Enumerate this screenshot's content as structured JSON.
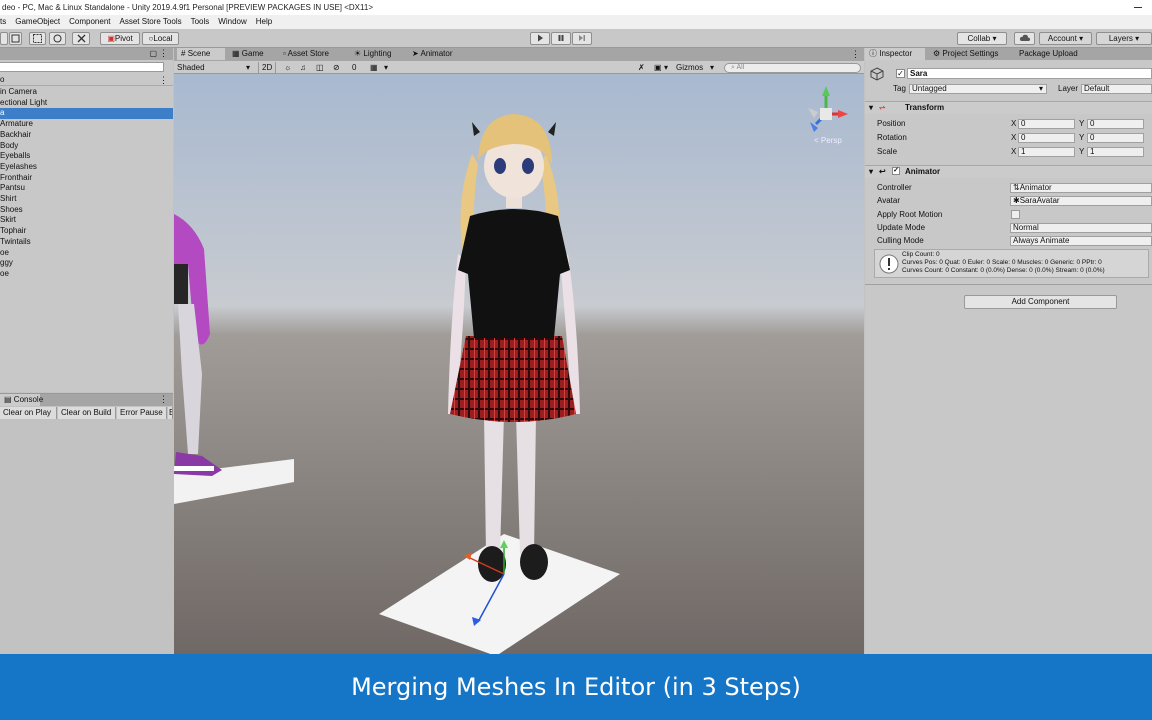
{
  "window": {
    "title": "deo - PC, Mac & Linux Standalone - Unity 2019.4.9f1 Personal [PREVIEW PACKAGES IN USE] <DX11>"
  },
  "menu": [
    "ts",
    "GameObject",
    "Component",
    "Asset Store Tools",
    "Tools",
    "Window",
    "Help"
  ],
  "toolbar": {
    "pivot": "Pivot",
    "local": "Local",
    "collab": "Collab",
    "account": "Account",
    "layers": "Layers"
  },
  "hierarchy": {
    "items": [
      {
        "label": "in Camera"
      },
      {
        "label": "ectional Light"
      },
      {
        "label": "a"
      },
      {
        "label": "Armature"
      },
      {
        "label": "Backhair"
      },
      {
        "label": "Body"
      },
      {
        "label": "Eyeballs"
      },
      {
        "label": "Eyelashes"
      },
      {
        "label": "Fronthair"
      },
      {
        "label": "Pantsu"
      },
      {
        "label": "Shirt"
      },
      {
        "label": "Shoes"
      },
      {
        "label": "Skirt"
      },
      {
        "label": "Tophair"
      },
      {
        "label": "Twintails"
      },
      {
        "label": "oe"
      },
      {
        "label": "ggy"
      },
      {
        "label": "oe"
      }
    ]
  },
  "console": {
    "tab": "Console",
    "clear_on_play": "Clear on Play",
    "clear_on_build": "Clear on Build",
    "error_pause": "Error Pause",
    "editor_cut": "E"
  },
  "scene": {
    "tabs": [
      "Scene",
      "Game",
      "Asset Store",
      "Lighting",
      "Animator"
    ],
    "shading": "Shaded",
    "mode_2d": "2D",
    "hidden_count": "0",
    "gizmos": "Gizmos",
    "search_placeholder": "All",
    "persp": "Persp"
  },
  "inspector": {
    "tabs": [
      "Inspector",
      "Project Settings",
      "Package Upload"
    ],
    "object_name": "Sara",
    "tag_label": "Tag",
    "tag_value": "Untagged",
    "layer_label": "Layer",
    "layer_value": "Default",
    "transform": {
      "header": "Transform",
      "position_label": "Position",
      "rotation_label": "Rotation",
      "scale_label": "Scale",
      "position": {
        "x": "0",
        "y": "0"
      },
      "rotation": {
        "x": "0",
        "y": "0"
      },
      "scale": {
        "x": "1",
        "y": "1"
      },
      "x_label": "X",
      "y_label": "Y"
    },
    "animator": {
      "header": "Animator",
      "controller_label": "Controller",
      "controller_value": "Animator",
      "avatar_label": "Avatar",
      "avatar_value": "SaraAvatar",
      "apply_root_motion_label": "Apply Root Motion",
      "update_mode_label": "Update Mode",
      "update_mode_value": "Normal",
      "culling_mode_label": "Culling Mode",
      "culling_mode_value": "Always Animate",
      "info_line1": "Clip Count: 0",
      "info_line2": "Curves Pos: 0 Quat: 0 Euler: 0 Scale: 0 Muscles: 0 Generic: 0 PPtr: 0",
      "info_line3": "Curves Count: 0 Constant: 0 (0.0%) Dense: 0 (0.0%) Stream: 0 (0.0%)"
    },
    "add_component": "Add Component"
  },
  "banner": {
    "text": "Merging Meshes In Editor (in 3 Steps)"
  }
}
